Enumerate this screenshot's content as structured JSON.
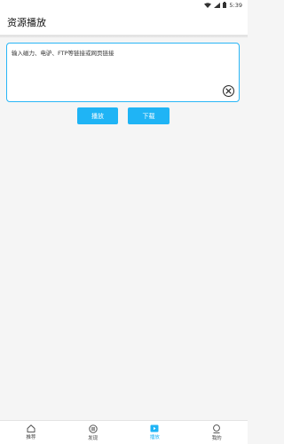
{
  "status_bar": {
    "time": "5:39",
    "icons": [
      "wifi-icon",
      "signal-icon",
      "battery-icon"
    ]
  },
  "header": {
    "title": "资源播放"
  },
  "input": {
    "placeholder": "输入磁力、电驴、FTP等链接或网页链接",
    "value": ""
  },
  "actions": {
    "play_label": "播放",
    "download_label": "下载"
  },
  "tabbar": {
    "items": [
      {
        "label": "推荐",
        "icon": "home-icon",
        "active": false
      },
      {
        "label": "发现",
        "icon": "discover-icon",
        "active": false
      },
      {
        "label": "播放",
        "icon": "play-icon",
        "active": true
      },
      {
        "label": "我的",
        "icon": "profile-icon",
        "active": false
      }
    ]
  },
  "colors": {
    "accent": "#1fb4f5",
    "input_border": "#29b6f6",
    "background": "#f5f5f5"
  }
}
